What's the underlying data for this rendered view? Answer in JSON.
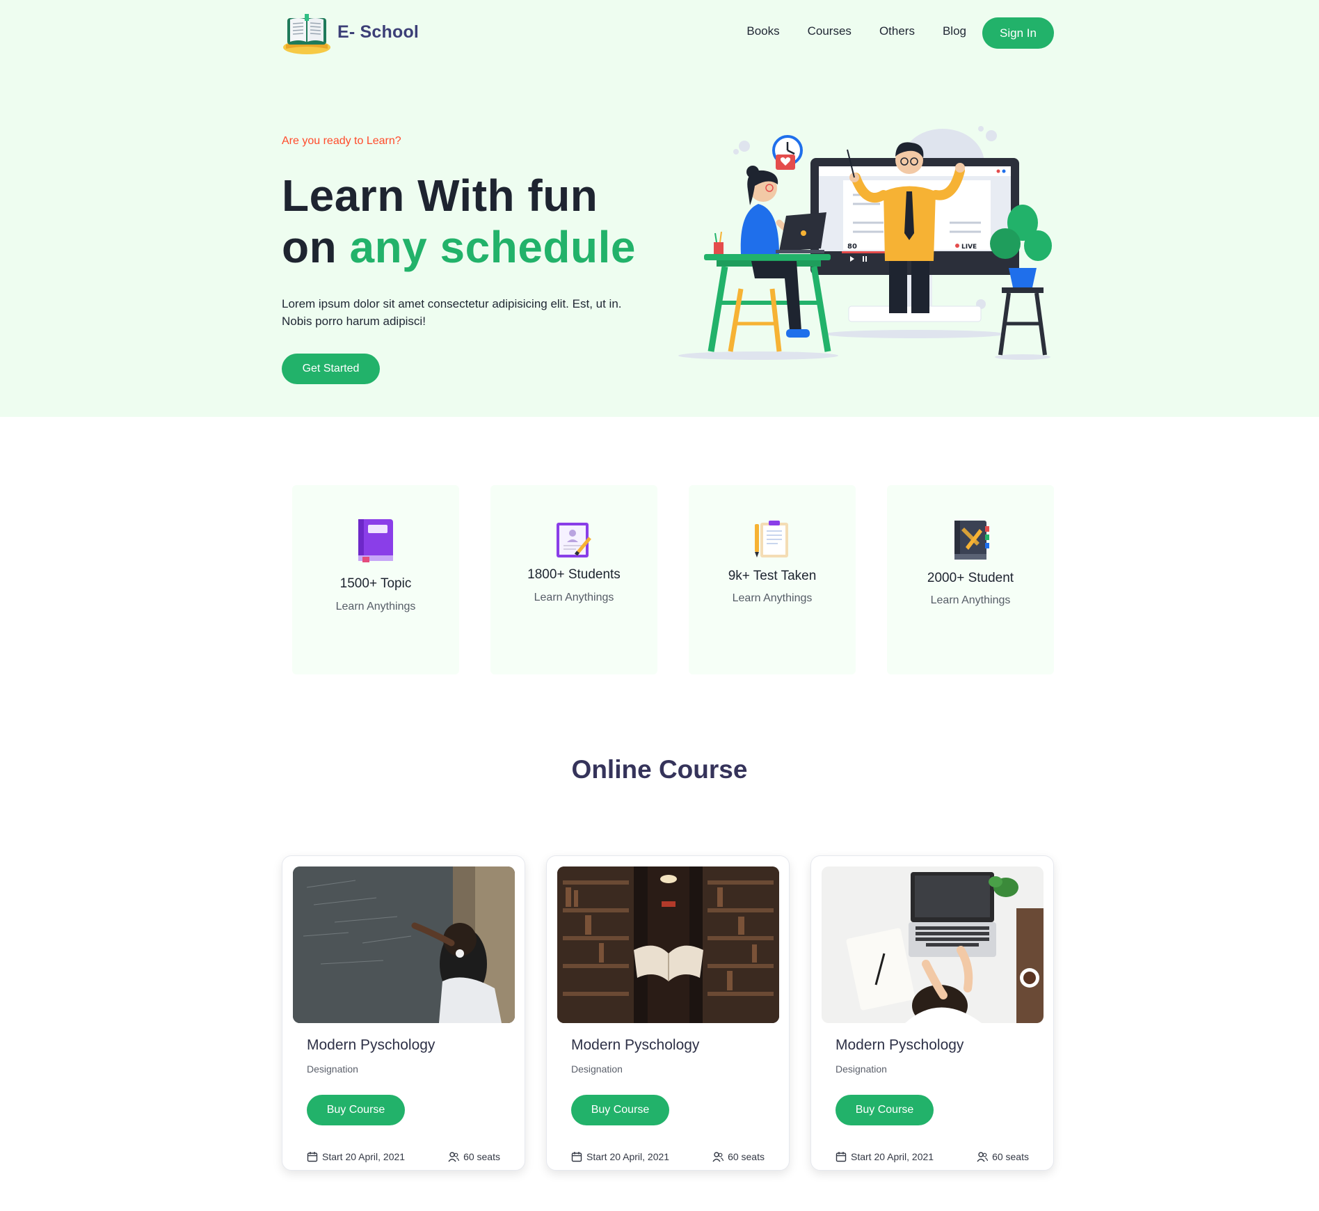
{
  "header": {
    "brand": "E- School",
    "menu": [
      "Books",
      "Courses",
      "Others",
      "Blog"
    ],
    "signin_label": "Sign In"
  },
  "hero": {
    "kicker": "Are you ready to Learn?",
    "title_line1": "Learn With fun",
    "title_line2_prefix": "on ",
    "title_line2_accent": "any schedule",
    "description_line1": "Lorem ipsum dolor sit amet consectetur adipisicing elit. Est, ut in.",
    "description_line2": "Nobis porro harum adipisci!",
    "cta_label": "Get Started",
    "illustration": {
      "viewer_count": "80",
      "live_label": "LIVE"
    }
  },
  "stats": [
    {
      "number": "1500+ Topic",
      "caption": "Learn Anythings",
      "icon": "book-icon"
    },
    {
      "number": "1800+ Students",
      "caption": "Learn Anythings",
      "icon": "certificate-icon"
    },
    {
      "number": "9k+ Test Taken",
      "caption": "Learn Anythings",
      "icon": "clipboard-test-icon"
    },
    {
      "number": "2000+ Student",
      "caption": "Learn Anythings",
      "icon": "notebook-icon"
    }
  ],
  "courses_section": {
    "title": "Online Course",
    "cards": [
      {
        "title": "Modern Pyschology",
        "designation": "Designation",
        "buy_label": "Buy Course",
        "start": "Start 20 April, 2021",
        "seats": "60 seats"
      },
      {
        "title": "Modern Pyschology",
        "designation": "Designation",
        "buy_label": "Buy Course",
        "start": "Start 20 April, 2021",
        "seats": "60 seats"
      },
      {
        "title": "Modern Pyschology",
        "designation": "Designation",
        "buy_label": "Buy Course",
        "start": "Start 20 April, 2021",
        "seats": "60 seats"
      }
    ]
  },
  "colors": {
    "primary": "#22b26a",
    "hero_background": "#eefdf0",
    "kicker": "#ff4b2b",
    "heading_dark": "#1e2430",
    "section_title": "#35335a"
  }
}
